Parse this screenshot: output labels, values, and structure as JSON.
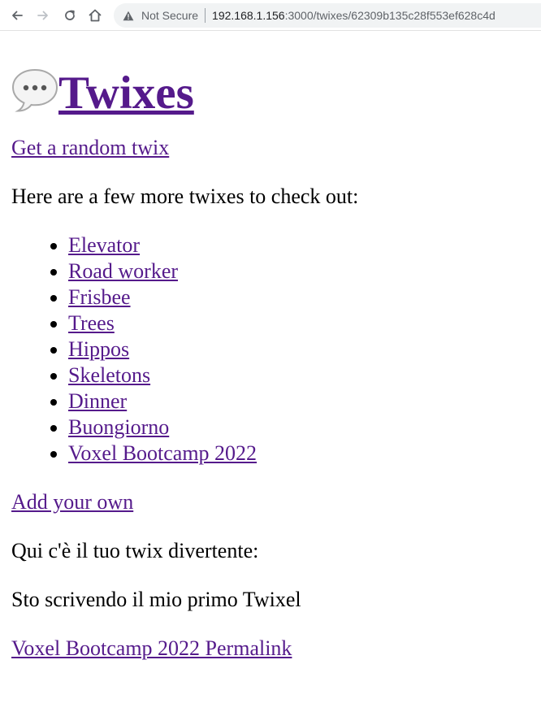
{
  "browser": {
    "security_label": "Not Secure",
    "url_host": "192.168.1.156",
    "url_path": ":3000/twixes/62309b135c28f553ef628c4d",
    "icons": {
      "back": "back-arrow-icon",
      "forward": "forward-arrow-icon",
      "reload": "reload-icon",
      "home": "home-icon",
      "warning": "warning-triangle-icon"
    }
  },
  "page": {
    "title_emoji": "speech-bubble-icon",
    "title": "Twixes",
    "random_link": "Get a random twix",
    "intro": "Here are a few more twixes to check out:",
    "twixes": [
      "Elevator",
      "Road worker",
      "Frisbee",
      "Trees",
      "Hippos",
      "Skeletons",
      "Dinner",
      "Buongiorno",
      "Voxel Bootcamp 2022"
    ],
    "add_link": "Add your own",
    "twix_heading": "Qui c'è il tuo twix divertente:",
    "twix_content": "Sto scrivendo il mio primo Twixel",
    "permalink": "Voxel Bootcamp 2022 Permalink",
    "colors": {
      "link": "#551a8b",
      "text": "#000000"
    }
  }
}
